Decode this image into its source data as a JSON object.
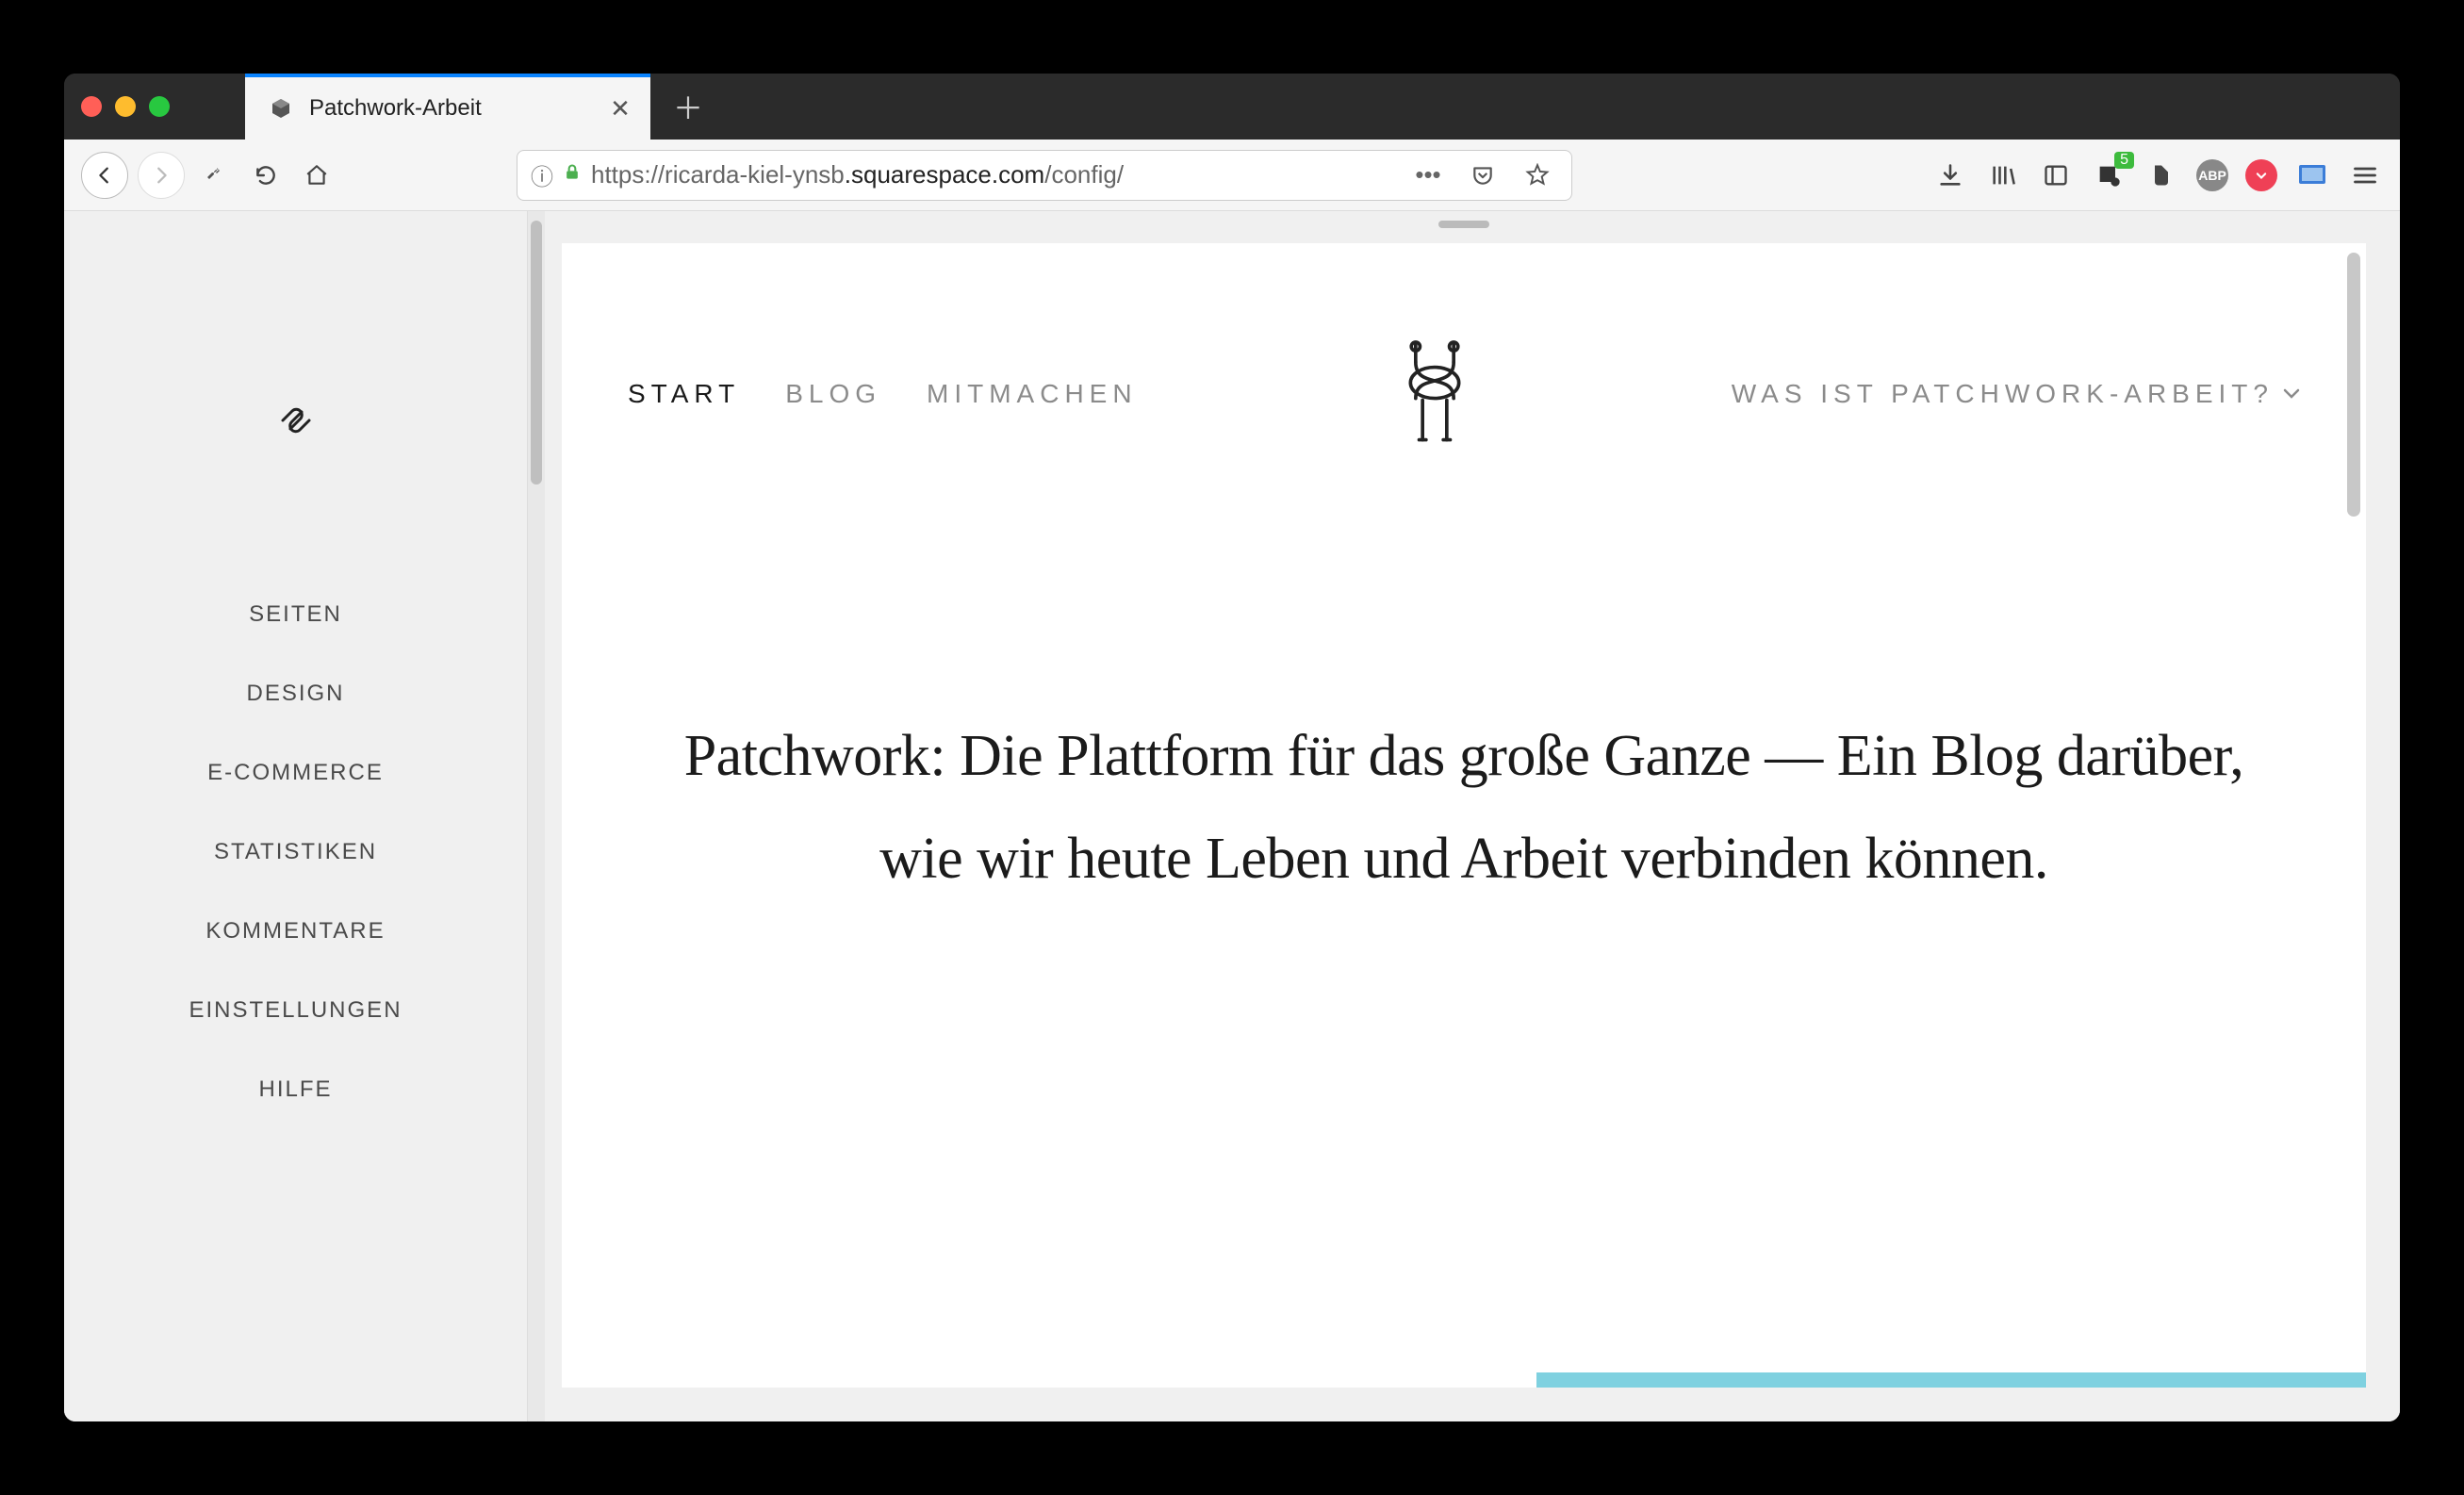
{
  "browser": {
    "tab_title": "Patchwork-Arbeit",
    "url_prefix": "https://ricarda-kiel-ynsb",
    "url_domain": ".squarespace.com",
    "url_path": "/config/"
  },
  "extensions": {
    "badge_count": "5",
    "abp_label": "ABP"
  },
  "sidebar": {
    "items": [
      "SEITEN",
      "DESIGN",
      "E-COMMERCE",
      "STATISTIKEN",
      "KOMMENTARE",
      "EINSTELLUNGEN",
      "HILFE"
    ]
  },
  "site": {
    "nav_left": [
      {
        "label": "START",
        "active": true
      },
      {
        "label": "BLOG",
        "active": false
      },
      {
        "label": "MITMACHEN",
        "active": false
      }
    ],
    "nav_right_label": "WAS IST PATCHWORK-ARBEIT?",
    "hero_heading": "Patchwork: Die Plattform für das große Ganze — Ein Blog darüber, wie wir heute Leben und Arbeit verbinden können."
  }
}
